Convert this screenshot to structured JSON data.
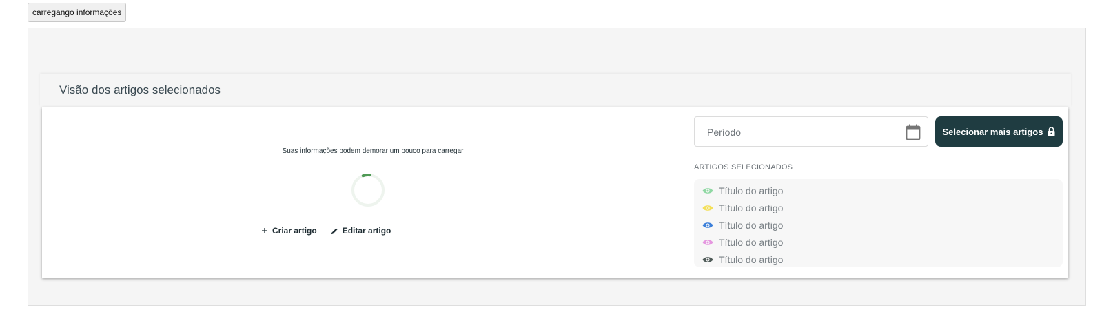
{
  "top_button": {
    "label": "carregango informações"
  },
  "card": {
    "title": "Visão dos artigos selecionados",
    "loading_notice": "Suas informações podem demorar um pouco para carregar",
    "spinner_color": "#4f9a55",
    "actions": {
      "create_label": "Criar artigo",
      "edit_label": "Editar artigo"
    }
  },
  "filter": {
    "period_placeholder": "Período",
    "period_value": "",
    "icon": "calendar-icon"
  },
  "select_button": {
    "label": "Selecionar mais artigos",
    "icon": "lock-icon",
    "bg_color": "#1f3c41"
  },
  "selected_articles": {
    "heading": "ARTIGOS SELECIONADOS",
    "items": [
      {
        "title": "Título do artigo",
        "eye_color": "#8fd8a3"
      },
      {
        "title": "Título do artigo",
        "eye_color": "#f4e05a"
      },
      {
        "title": "Título do artigo",
        "eye_color": "#3b7fd9"
      },
      {
        "title": "Título do artigo",
        "eye_color": "#e597e0"
      },
      {
        "title": "Título do artigo",
        "eye_color": "#4f5b58"
      }
    ]
  }
}
